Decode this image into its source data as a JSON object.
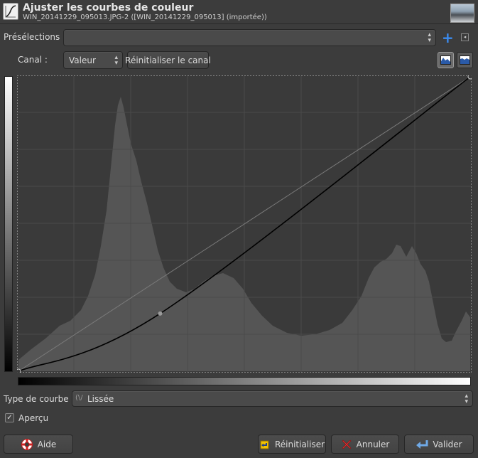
{
  "header": {
    "title": "Ajuster les courbes de couleur",
    "subtitle": "WIN_20141229_095013.JPG-2 ([WIN_20141229_095013] (importée))"
  },
  "presets": {
    "label": "Présélections :",
    "value": ""
  },
  "channel": {
    "label": "Canal :",
    "value": "Valeur",
    "reset_label": "Réinitialiser le canal"
  },
  "curve_type": {
    "label": "Type de courbe :",
    "value": "Lissée",
    "glyph": "(\\/"
  },
  "preview": {
    "label": "Aperçu",
    "checked": true
  },
  "buttons": {
    "help": "Aide",
    "reset": "Réinitialiser",
    "cancel": "Annuler",
    "ok": "Valider"
  },
  "icons": {
    "add": "+",
    "tri": "◂",
    "check": "✓"
  },
  "colors": {
    "bg": "#3c3c3c",
    "accent": "#3b8cf0",
    "cancel": "#e23a3a"
  },
  "curve": {
    "points": [
      [
        0,
        0
      ],
      [
        80,
        50
      ],
      [
        255,
        255
      ]
    ]
  }
}
